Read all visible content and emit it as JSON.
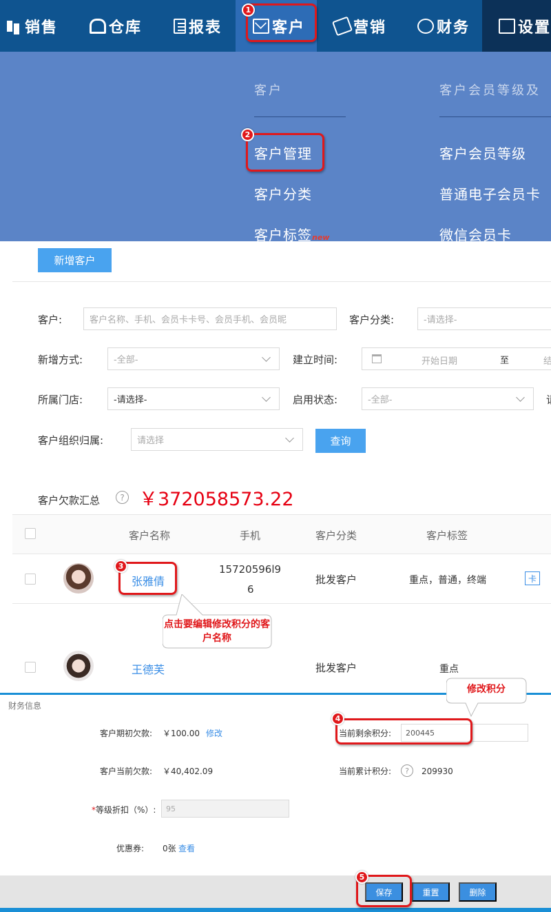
{
  "nav": {
    "items": [
      {
        "label": "销售",
        "icon": "sales-icon"
      },
      {
        "label": "仓库",
        "icon": "warehouse-icon"
      },
      {
        "label": "报表",
        "icon": "report-icon"
      },
      {
        "label": "客户",
        "icon": "customer-icon",
        "active": true
      },
      {
        "label": "营销",
        "icon": "marketing-icon"
      },
      {
        "label": "财务",
        "icon": "finance-icon"
      },
      {
        "label": "设置",
        "icon": "settings-icon"
      }
    ]
  },
  "dropdown": {
    "col1": {
      "heading": "客户",
      "links": [
        "客户管理",
        "客户分类",
        "客户标签"
      ],
      "new_badge": "new"
    },
    "col2": {
      "heading": "客户会员等级及",
      "links": [
        "客户会员等级",
        "普通电子会员卡",
        "微信会员卡"
      ]
    }
  },
  "toolbar": {
    "add_customer": "新增客户"
  },
  "filters": {
    "customer_label": "客户:",
    "customer_placeholder": "客户名称、手机、会员卡卡号、会员手机、会员昵",
    "category_label": "客户分类:",
    "category_value": "-请选择-",
    "add_method_label": "新增方式:",
    "add_method_value": "-全部-",
    "created_label": "建立时间:",
    "start_date": "开始日期",
    "to_text": "至",
    "end_date_partial": "结",
    "store_label": "所属门店:",
    "store_value": "-请选择-",
    "status_label": "启用状态:",
    "status_value": "-全部-",
    "truncated_label": "请",
    "org_label": "客户组织归属:",
    "org_value": "请选择",
    "query_button": "查询"
  },
  "summary": {
    "label": "客户欠款汇总",
    "help": "?",
    "amount": "￥372058573.22"
  },
  "table": {
    "headers": [
      "客户名称",
      "手机",
      "客户分类",
      "客户标签"
    ],
    "rows": [
      {
        "name": "张雅倩",
        "phone_line1": "15720596l9",
        "phone_line2": "6",
        "category": "批发客户",
        "tags": "重点，普通，终端",
        "card": "卡"
      },
      {
        "name": "王德芙",
        "phone_line1": "",
        "phone_line2": "",
        "category": "批发客户",
        "tags": "重点",
        "card": ""
      }
    ]
  },
  "finance": {
    "title": "财务信息",
    "opening_debt_label": "客户期初欠款:",
    "opening_debt_value": "￥100.00",
    "edit_link": "修改",
    "current_debt_label": "客户当前欠款:",
    "current_debt_value": "￥40,402.09",
    "discount_label": "等级折扣（%）:",
    "discount_required": "*",
    "discount_value": "95",
    "coupon_label": "优惠券:",
    "coupon_value": "0张",
    "coupon_link": "查看",
    "remaining_points_label": "当前剩余积分:",
    "remaining_points_value": "200445",
    "total_points_label": "当前累计积分:",
    "total_points_help": "?",
    "total_points_value": "209930",
    "save_button": "保存",
    "reset_button": "重置",
    "delete_button": "删除"
  },
  "annotations": {
    "badges": [
      "1",
      "2",
      "3",
      "4",
      "5"
    ],
    "callout_click": "点击要编辑修改积分的客户名称",
    "callout_edit": "修改积分"
  },
  "colors": {
    "nav_bg": "#0f5490",
    "nav_active": "#2d6cb6",
    "dropdown_bg": "#5b84c7",
    "primary": "#49a3ef",
    "link": "#3a8ee6",
    "amount_red": "#e60012",
    "annotation_red": "#e0181b"
  }
}
